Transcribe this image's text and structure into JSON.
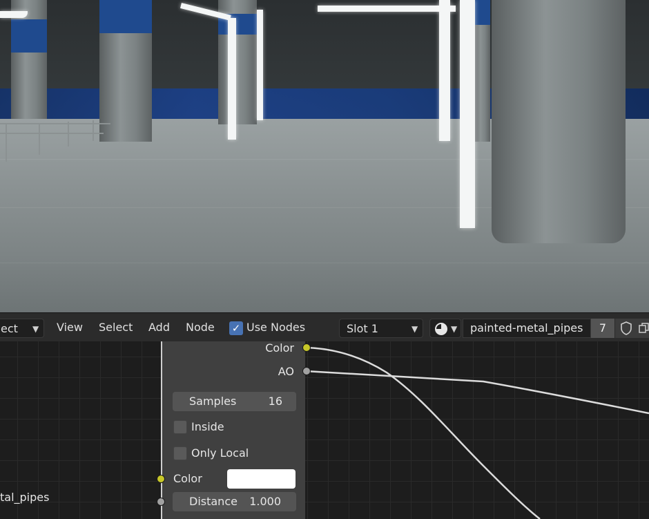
{
  "header": {
    "editor_type_partial": "ect",
    "menu": [
      "View",
      "Select",
      "Add",
      "Node"
    ],
    "use_nodes": {
      "label": "Use Nodes",
      "checked": true
    },
    "slot": "Slot 1",
    "material_name": "painted-metal_pipes",
    "user_count": "7"
  },
  "node": {
    "outputs": [
      {
        "label": "Color",
        "socket": "yellow"
      },
      {
        "label": "AO",
        "socket": "grey"
      }
    ],
    "samples": {
      "label": "Samples",
      "value": "16"
    },
    "inside": {
      "label": "Inside",
      "checked": false
    },
    "only_local": {
      "label": "Only Local",
      "checked": false
    },
    "color_input": {
      "label": "Color",
      "value": "#ffffff"
    },
    "distance": {
      "label": "Distance",
      "value": "1.000"
    }
  },
  "partial_node_label": "tal_pipes",
  "colors": {
    "accent": "#4772b3",
    "socket_yellow": "#c7c729",
    "socket_grey": "#a1a1a1"
  }
}
